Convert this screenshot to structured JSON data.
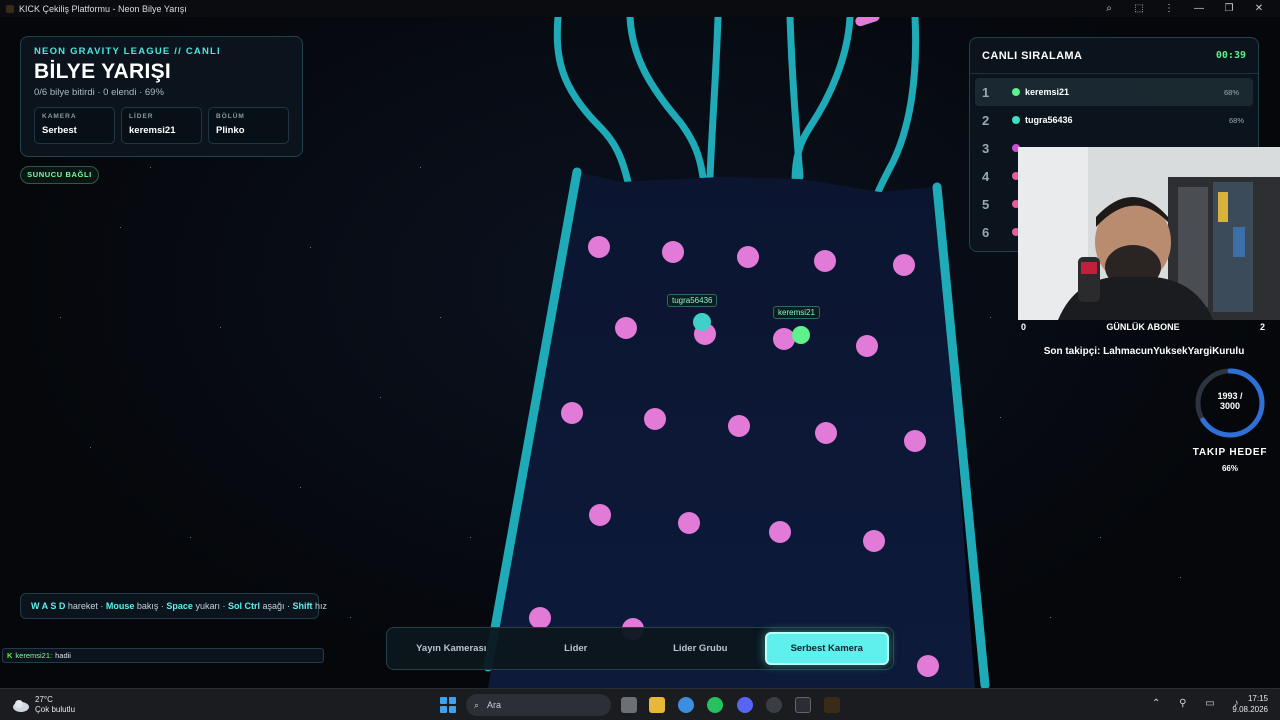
{
  "window": {
    "title": "KICK Çekiliş Platformu - Neon Bilye Yarışı",
    "controls": [
      "⌕",
      "⬚",
      "⋮",
      "—",
      "❐",
      "✕"
    ]
  },
  "info_panel": {
    "league": "NEON GRAVITY LEAGUE // CANLI",
    "title": "BİLYE YARIŞI",
    "status": "0/6 bilye bitirdi · 0 elendi · 69%",
    "stats": [
      {
        "label": "KAMERA",
        "value": "Serbest"
      },
      {
        "label": "LİDER",
        "value": "keremsi21"
      },
      {
        "label": "BÖLÜM",
        "value": "Plinko"
      }
    ]
  },
  "server_badge": "SUNUCU BAĞLI",
  "controls_hint": [
    {
      "key": "W A S D",
      "text": " hareket · "
    },
    {
      "key": "Mouse",
      "text": " bakış · "
    },
    {
      "key": "Space",
      "text": " yukarı · "
    },
    {
      "key": "Sol Ctrl",
      "text": " aşağı · "
    },
    {
      "key": "Shift",
      "text": " hız"
    }
  ],
  "chat": {
    "platform": "K",
    "user": "keremsi21:",
    "message": "hadii"
  },
  "camera_buttons": [
    {
      "label": "Yayın Kamerası",
      "active": false
    },
    {
      "label": "Lider",
      "active": false
    },
    {
      "label": "Lider Grubu",
      "active": false
    },
    {
      "label": "Serbest Kamera",
      "active": true
    }
  ],
  "ranking": {
    "title": "CANLI SIRALAMA",
    "timer": "00:39",
    "rows": [
      {
        "rank": "1",
        "name": "keremsi21",
        "pct": "68%",
        "color": "#5ef08a"
      },
      {
        "rank": "2",
        "name": "tugra56436",
        "pct": "68%",
        "color": "#3fe0c0"
      },
      {
        "rank": "3",
        "name": "",
        "pct": "",
        "color": "#d04cd8"
      },
      {
        "rank": "4",
        "name": "",
        "pct": "",
        "color": "#e85c9a"
      },
      {
        "rank": "5",
        "name": "",
        "pct": "",
        "color": "#e85c9a"
      },
      {
        "rank": "6",
        "name": "",
        "pct": "",
        "color": "#e85c9a"
      }
    ]
  },
  "stream_overlay": {
    "sub_left": "0",
    "sub_label": "GÜNLÜK ABONE",
    "sub_right": "2",
    "last_follower": "Son takipçi: LahmacunYuksekYargiKurulu",
    "goal_current": "1993 /",
    "goal_target": "3000",
    "goal_label": "TAKIP HEDEF",
    "goal_pct": "66%",
    "goal_progress": 0.66
  },
  "marble_tags": [
    {
      "name": "tugra56436"
    },
    {
      "name": "keremsi21"
    }
  ],
  "taskbar": {
    "temp": "27°C",
    "weather": "Çok bulutlu",
    "search": "Ara",
    "time": "17:15",
    "date": "9.08.2026"
  },
  "colors": {
    "accent": "#5ff0ee",
    "track": "#1faab8",
    "peg": "#e27bd8",
    "leader": "#5ef08a"
  }
}
